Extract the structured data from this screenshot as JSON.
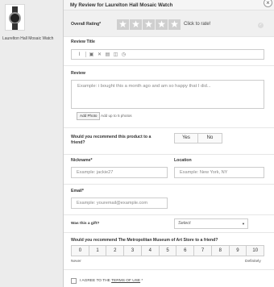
{
  "product": {
    "name": "Laurelton Hall Mosaic Watch"
  },
  "modal": {
    "title": "My Review for Laurelton Hall Mosaic Watch",
    "close_icon": "close-icon"
  },
  "rating": {
    "label": "Overall Rating*",
    "value": 0,
    "max": 5,
    "hint": "Click to rate!"
  },
  "review_title": {
    "label": "Review Title",
    "toolbar_icons": [
      "text-format-icon",
      "image-icon",
      "link-icon",
      "table-icon",
      "gallery-icon",
      "clock-icon"
    ]
  },
  "review": {
    "label": "Review",
    "placeholder": "Example: i bought this a month ago and am so happy that I did...",
    "add_photo": "Add Photo",
    "photo_note": "Add up to 5 photos"
  },
  "recommend": {
    "label": "Would you recommend this product to a friend?",
    "yes": "Yes",
    "no": "No"
  },
  "nickname": {
    "label": "Nickname*",
    "placeholder": "Example: jackie27"
  },
  "location": {
    "label": "Location",
    "placeholder": "Example: New York, NY"
  },
  "email": {
    "label": "Email*",
    "placeholder": "Example: youremail@example.com"
  },
  "gift": {
    "label": "Was this a gift?",
    "selected": "Select"
  },
  "nps": {
    "label": "Would you recommend The Metropolitan Museum of Art Store to a friend?",
    "scale": [
      "0",
      "1",
      "2",
      "3",
      "4",
      "5",
      "6",
      "7",
      "8",
      "9",
      "10"
    ],
    "low_label": "Never",
    "high_label": "Definitely"
  },
  "agree": {
    "prefix": "I AGREE TO THE ",
    "link": "TERMS OF USE",
    "suffix": " *"
  },
  "colors": {
    "star_empty": "#cfcfcf",
    "panel_bg": "#ececec",
    "rating_bg": "#f0f0f0"
  }
}
